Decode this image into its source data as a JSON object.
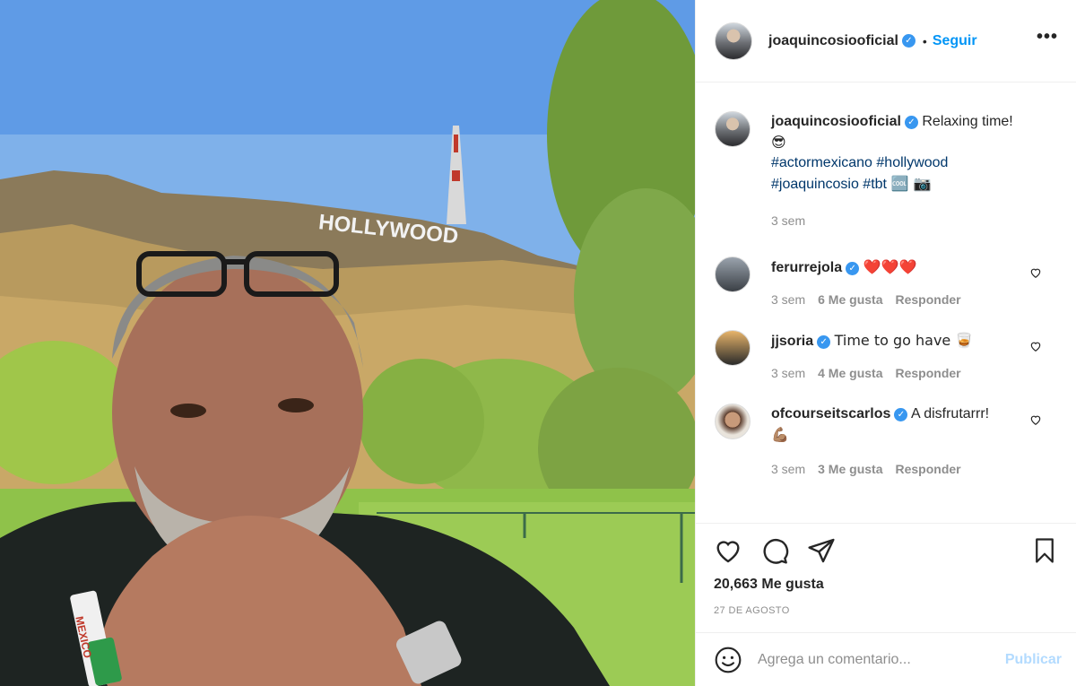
{
  "header": {
    "username": "joaquincosiooficial",
    "separator": "•",
    "follow_label": "Seguir",
    "more_label": "•••"
  },
  "caption": {
    "username": "joaquincosiooficial",
    "text": "Relaxing time!",
    "emoji": "😎",
    "hashtags_line1": "#actormexicano #hollywood",
    "hashtags_line2": "#joaquincosio #tbt",
    "emoji_tail": "🆒 📷",
    "time": "3 sem"
  },
  "comments": [
    {
      "username": "ferurrejola",
      "text": "❤️❤️❤️",
      "time": "3 sem",
      "likes": "6 Me gusta",
      "reply": "Responder"
    },
    {
      "username": "jjsoria",
      "text": "Time to go have 🥃",
      "time": "3 sem",
      "likes": "4 Me gusta",
      "reply": "Responder"
    },
    {
      "username": "ofcourseitscarlos",
      "text": "A disfrutarrr!",
      "text2": "💪🏽",
      "time": "3 sem",
      "likes": "3 Me gusta",
      "reply": "Responder"
    }
  ],
  "stats": {
    "likes": "20,663 Me gusta",
    "date": "27 DE AGOSTO"
  },
  "add_comment": {
    "placeholder": "Agrega un comentario...",
    "publish_label": "Publicar"
  },
  "photo": {
    "sign_text": "HOLLYWOOD",
    "wristband_text": "MEXICO"
  },
  "colors": {
    "accent": "#0095f6",
    "verified": "#3897f0",
    "publish_disabled": "#b3dbff",
    "text_secondary": "#8e8e8e"
  },
  "icons": [
    "verified-icon",
    "more-icon",
    "heart-icon",
    "comment-icon",
    "share-icon",
    "bookmark-icon",
    "emoji-icon"
  ]
}
